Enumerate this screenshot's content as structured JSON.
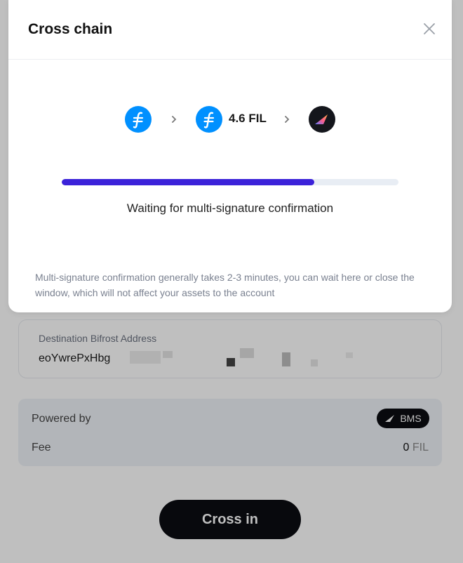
{
  "modal": {
    "title": "Cross chain",
    "route": {
      "amount": "4.6 FIL",
      "icons": [
        "filecoin-icon",
        "filecoin-icon",
        "bifrost-icon"
      ]
    },
    "progress": {
      "percent": 75,
      "color": "#3b22d9"
    },
    "status": "Waiting for multi-signature confirmation",
    "note": "Multi-signature confirmation generally takes 2-3 minutes, you can wait here or close the window, which will not affect your assets to the account"
  },
  "page": {
    "destination": {
      "label": "Destination Bifrost Address",
      "value": "eoYwrePxHbg"
    },
    "info": {
      "powered_by_label": "Powered by",
      "badge": "BMS",
      "fee_label": "Fee",
      "fee_value": "0",
      "fee_unit": "FIL"
    },
    "cross_button": "Cross in"
  },
  "colors": {
    "filecoin": "#0090ff",
    "accent": "#3b22d9",
    "button": "#0b0d12"
  }
}
